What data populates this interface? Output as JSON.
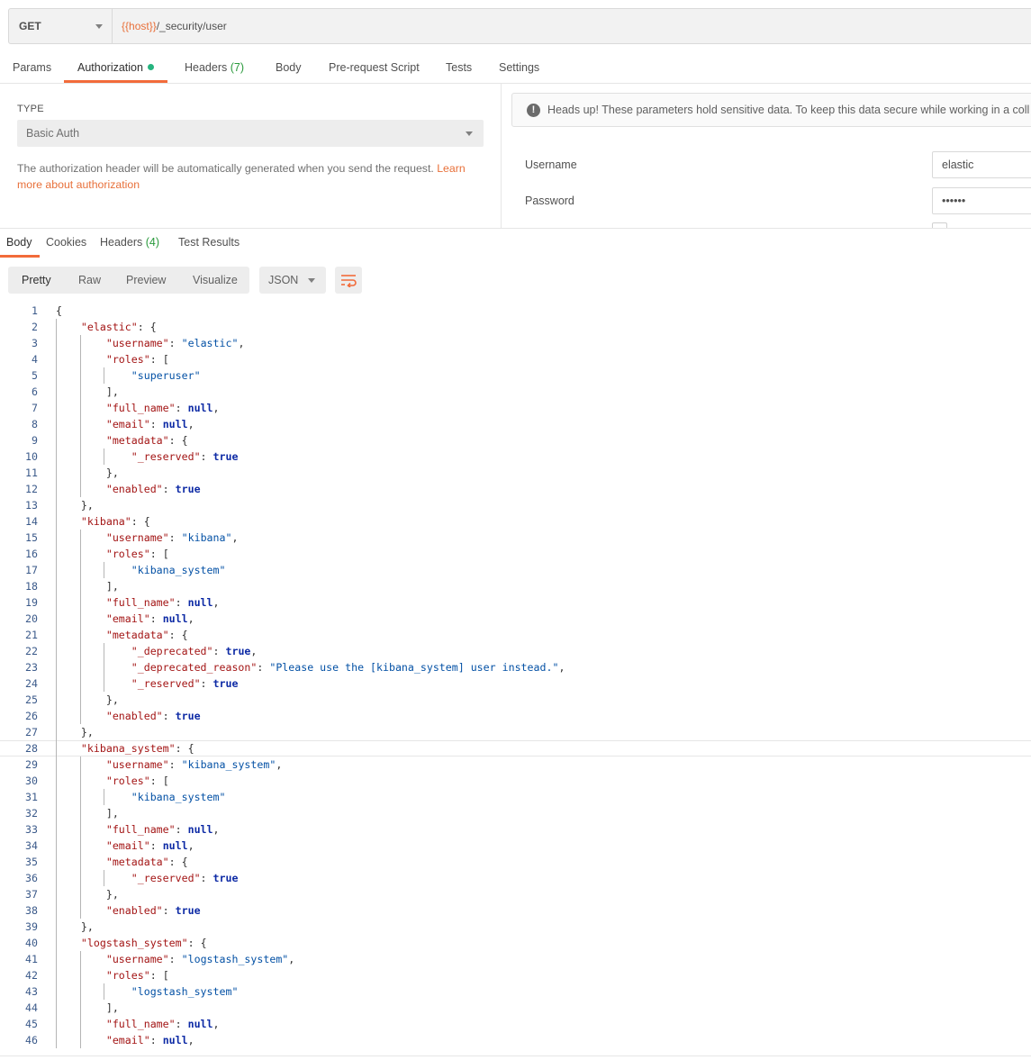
{
  "request": {
    "method": "GET",
    "url_var": "{{host}}",
    "url_path": "/_security/user"
  },
  "request_tabs": [
    {
      "label": "Params"
    },
    {
      "label": "Authorization",
      "active": true
    },
    {
      "label": "Headers",
      "count": "(7)"
    },
    {
      "label": "Body"
    },
    {
      "label": "Pre-request Script"
    },
    {
      "label": "Tests"
    },
    {
      "label": "Settings"
    }
  ],
  "auth": {
    "type_label": "TYPE",
    "type_value": "Basic Auth",
    "description": "The authorization header will be automatically generated when you send the request.",
    "learn_link": "Learn more about authorization",
    "warning": "Heads up! These parameters hold sensitive data. To keep this data secure while working in a coll",
    "username_label": "Username",
    "username_value": "elastic",
    "password_label": "Password",
    "password_value": "••••••"
  },
  "response_tabs": [
    {
      "label": "Body",
      "active": true
    },
    {
      "label": "Cookies"
    },
    {
      "label": "Headers",
      "count": "(4)"
    },
    {
      "label": "Test Results"
    }
  ],
  "view_modes": [
    {
      "label": "Pretty",
      "active": true
    },
    {
      "label": "Raw"
    },
    {
      "label": "Preview"
    },
    {
      "label": "Visualize"
    }
  ],
  "format": "JSON",
  "colors": {
    "accent": "#f26b3a",
    "key": "#a31515",
    "string": "#0451a5",
    "literal": "#0d2aa5"
  },
  "code_lines": [
    "{",
    "    \"elastic\": {",
    "        \"username\": \"elastic\",",
    "        \"roles\": [",
    "            \"superuser\"",
    "        ],",
    "        \"full_name\": null,",
    "        \"email\": null,",
    "        \"metadata\": {",
    "            \"_reserved\": true",
    "        },",
    "        \"enabled\": true",
    "    },",
    "    \"kibana\": {",
    "        \"username\": \"kibana\",",
    "        \"roles\": [",
    "            \"kibana_system\"",
    "        ],",
    "        \"full_name\": null,",
    "        \"email\": null,",
    "        \"metadata\": {",
    "            \"_deprecated\": true,",
    "            \"_deprecated_reason\": \"Please use the [kibana_system] user instead.\",",
    "            \"_reserved\": true",
    "        },",
    "        \"enabled\": true",
    "    },",
    "    \"kibana_system\": {",
    "        \"username\": \"kibana_system\",",
    "        \"roles\": [",
    "            \"kibana_system\"",
    "        ],",
    "        \"full_name\": null,",
    "        \"email\": null,",
    "        \"metadata\": {",
    "            \"_reserved\": true",
    "        },",
    "        \"enabled\": true",
    "    },",
    "    \"logstash_system\": {",
    "        \"username\": \"logstash_system\",",
    "        \"roles\": [",
    "            \"logstash_system\"",
    "        ],",
    "        \"full_name\": null,",
    "        \"email\": null,"
  ]
}
